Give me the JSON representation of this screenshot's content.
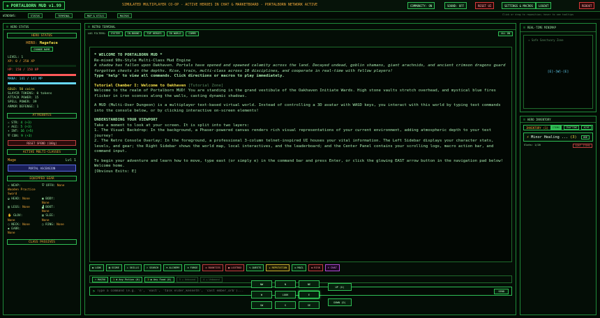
{
  "colors": {
    "accent": "#39ff6a",
    "amber": "#f2a93b",
    "hp": "#ff5a5a",
    "mana": "#67d9ff",
    "bg": "#030a04"
  },
  "topbar": {
    "brand": "PORTALBORN MUD v1.99",
    "banner": "SIMULATED MULTIPLAYER CO-OP - ACTIVE HEROES IN CHAT & MARKETBOARD - PORTALBORN NETWORK ACTIVE",
    "community": "COMMUNITY: ON",
    "sound": "SOUND: OFF",
    "reset": "RESET UI",
    "settings": "SETTINGS & MACROS",
    "logout": "LOGOUT",
    "reboot": "REBOOT"
  },
  "subbar": {
    "label": "WINDOWS:",
    "tabs": [
      "STATUS",
      "TERMINAL",
      "MAP & UTILS",
      "MACROS"
    ],
    "right": "Click or drag to reposition; hover to see tooltips"
  },
  "left": {
    "title": "HERO STATUS",
    "hero_section": "HERO STATUS",
    "hero_name_label": "HERO:",
    "hero_name": "Mageface",
    "change_name": "CHANGE NAME",
    "level": "LEVEL: 1",
    "xp": "XP: 0 / 250 XP",
    "xp_frac": 0.0,
    "hp": "HP: 150 / 150 HP",
    "hp_frac": 1.0,
    "mana": "MANA: 141 / 141 MP",
    "mana_frac": 1.0,
    "gold": "GOLD: 50 coins",
    "slayer": "SLAYER TOKENS: 0 tokens",
    "attack": "ATTACK POWER: 15",
    "spell": "SPELL POWER: 39",
    "armor": "ARMOR DEFENSE: 1",
    "attr_section": "ATTRIBUTES",
    "attrs": [
      {
        "name": "STR:",
        "val": "4 (+3)"
      },
      {
        "name": "AGI:",
        "val": "5 (+3)"
      },
      {
        "name": "INT:",
        "val": "16 (+5)"
      },
      {
        "name": "CON:",
        "val": "9 (+3)"
      }
    ],
    "reset_attrs": "RESET SPEND (100g)",
    "class_section": "ACTIVE MULTI-CLASSES",
    "class_name": "Mage",
    "class_level": "Lvl 1",
    "portal_btn": "PORTAL ASCENSION",
    "gear_section": "EQUIPPED GEAR",
    "gear": [
      [
        "WEAP:",
        "Wooden Practice Sword",
        "OFFH:",
        "None"
      ],
      [
        "HEAD:",
        "None",
        "BODY:",
        "None"
      ],
      [
        "LEGS:",
        "None",
        "BOOT:",
        "None"
      ],
      [
        "GLOV:",
        "None",
        "SLEE:",
        "None"
      ],
      [
        "NECK:",
        "None",
        "RING:",
        "None"
      ],
      [
        "EARR:",
        "None",
        "",
        ""
      ]
    ],
    "passives_section": "CLASS PASSIVES"
  },
  "center": {
    "title": "RETRO TERMINAL",
    "filter_label": "LOG FILTERS:",
    "filters": [
      "SYSTEM",
      "IN-BOUND",
      "TOP HEROES",
      "IN WORLD",
      "COMMS"
    ],
    "all": "ALL ON",
    "term": {
      "welcome": "* WELCOME TO PORTALBORN MUD *",
      "subtitle": "Re-mixed 90s-Style Multi-Class Mud Engine",
      "lore": "A shadow has fallen upon Oakhaven. Portals have opened and spawned calamity across the land. Decayed undead, goblin shamans, giant arachnids, and ancient crimson dragons guard forgotten chests in the depths. Rise, train, multi-class across 10 disciplines, and cooperate in real-time with fellow players!",
      "help": "Type 'help' to view all commands. Click directions or macros to play immediately.",
      "chamber": "Tutorial Chamber I: Welcome to Oakhaven",
      "zone": "[Tutorial Zone]",
      "chamber_desc": "Welcome to the realm of Portalborn MUD! You are standing in the grand vestibule of the Oakhaven Initiate Wards. High stone vaults stretch overhead, and mystical blue fires flicker in iron sconces along the walls, casting dynamic shadows.",
      "mud_desc": "A MUD (Multi-User Dungeon) is a multiplayer text-based virtual world. Instead of controlling a 3D avatar with WASD keys, you interact with this world by typing text commands into the console below, or by clicking interactive on-screen elements!",
      "viewport_title": "UNDERSTANDING YOUR VIEWPORT",
      "viewport_intro": "Take a moment to look at your screen. It is split into two layers:",
      "layer1": "1. The Visual Backdrop: In the background, a Phaser-powered canvas renders rich visual representations of your current environment, adding atmospheric depth to your text journey!",
      "layer2": "2. The Retro Console Overlay: In the foreground, a professional 3-column telnet-inspired UI houses your vital information. The Left Sidebar displays your character stats, levels, and gear; the Right Sidebar shows the world map, local interactives, and the leaderboard; and the Center Panel contains your scrolling logs, macro action bar, and command input.",
      "begin": "To begin your adventure and learn how to move, type east (or simply e) in the command bar and press Enter, or click the glowing EAST arrow button in the navigation pad below! Welcome home.",
      "exits": "[Obvious Exits: E]"
    },
    "actions": [
      "LOOK",
      "SCORE",
      "SKILLS",
      "SEARCH",
      "ALCHEMY",
      "FORGE",
      "BOUNTIES",
      "LOOTBOX",
      "QUESTS",
      "REPUTATION",
      "MAIL",
      "RISK",
      "CHAT"
    ],
    "macros_label": "MACRO",
    "macros": [
      {
        "key": "1",
        "label": "Any Potion",
        "n": "(0)"
      },
      {
        "key": "2",
        "label": "Any Food",
        "n": "(0)"
      },
      {
        "key": "3",
        "label": "Unbound",
        "n": ""
      },
      {
        "key": "4",
        "label": "Unbound",
        "n": ""
      }
    ],
    "cmd_placeholder": "Type a command (e.g. 'n', 'east', 'talk elder_kenneth', 'cast ember_orb')...",
    "send": "SEND",
    "nav": {
      "nw": "NW",
      "n": "N",
      "ne": "NE",
      "w": "W",
      "look": "LOOK",
      "e": "E",
      "sw": "SW",
      "s": "S",
      "se": "SE",
      "up": "UP (U)",
      "down": "DOWN (D)"
    }
  },
  "right": {
    "map_title": "REAL-TIME MINIMAP",
    "map_zone": "Safe Sanctuary Zone",
    "map_cell": "[E]-[W]-[E]",
    "inv_title": "HERO INVENTORY",
    "inv_label": "INVENTORY",
    "inv_count": "(1)",
    "inv_tabs": [
      "ITEMS",
      "CRAFTING",
      "ACHS"
    ],
    "item_name": "Minor Healing ...",
    "item_count": "(3)",
    "item_use": "USE",
    "slots": "Slots: 1/20",
    "sort": "SORT ITEMS"
  }
}
